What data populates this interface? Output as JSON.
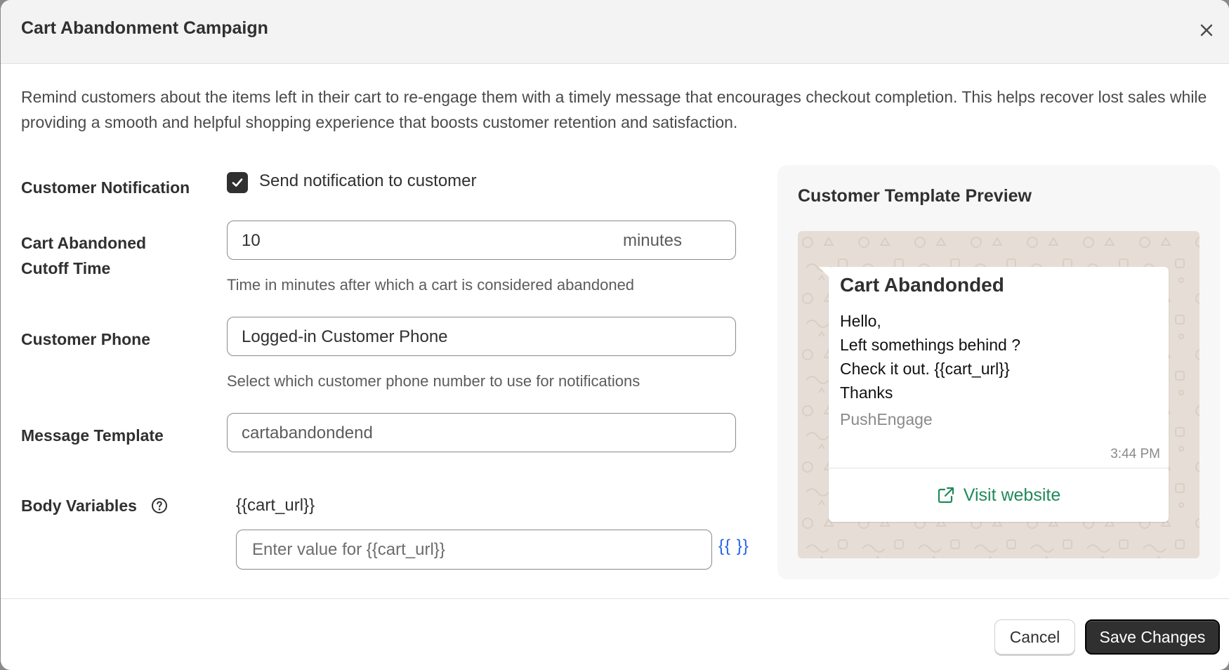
{
  "modal": {
    "title": "Cart Abandonment Campaign",
    "description": "Remind customers about the items left in their cart to re-engage them with a timely message that encourages checkout completion. This helps recover lost sales while providing a smooth and helpful shopping experience that boosts customer retention and satisfaction."
  },
  "form": {
    "notification": {
      "label": "Customer Notification",
      "checkbox_label": "Send notification to customer",
      "checked": true
    },
    "cutoff": {
      "label_line1": "Cart Abandoned",
      "label_line2": "Cutoff Time",
      "value": "10",
      "suffix": "minutes",
      "help": "Time in minutes after which a cart is considered abandoned"
    },
    "phone": {
      "label": "Customer Phone",
      "value": "Logged-in Customer Phone",
      "help": "Select which customer phone number to use for notifications"
    },
    "template": {
      "label": "Message Template",
      "value": "cartabandondend"
    },
    "body_variables": {
      "label": "Body Variables",
      "variable_name": "{{cart_url}}",
      "placeholder": "Enter value for {{cart_url}}",
      "insert_label": "{{ }}"
    }
  },
  "preview": {
    "title": "Customer Template Preview",
    "message": {
      "header": "Cart Abandonded",
      "body_lines": [
        "Hello,",
        "Left somethings behind ?",
        "Check it out. {{cart_url}}",
        "Thanks"
      ],
      "footer": "PushEngage",
      "time": "3:44 PM",
      "cta_label": "Visit website"
    }
  },
  "actions": {
    "cancel_label": "Cancel",
    "save_label": "Save Changes"
  },
  "colors": {
    "primary_dark": "#303030",
    "link_blue": "#2463eb",
    "whatsapp_green": "#1f8a5a",
    "chat_bg": "#e6ded6"
  },
  "icons": {
    "close": "close-icon",
    "check": "check-icon",
    "help": "question-circle-icon",
    "external": "external-link-icon"
  }
}
